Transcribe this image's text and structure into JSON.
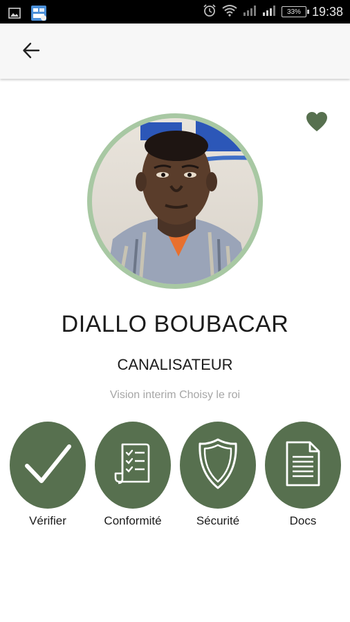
{
  "status_bar": {
    "time": "19:38",
    "battery": "33%",
    "left_icons": [
      "gallery-icon",
      "app-notification-icon"
    ],
    "right_icons": [
      "alarm-icon",
      "wifi-icon",
      "signal-icon",
      "signal-icon",
      "battery-icon"
    ]
  },
  "app_bar": {
    "back_icon": "arrow-left-icon"
  },
  "profile": {
    "name": "DIALLO BOUBACAR",
    "job_title": "CANALISATEUR",
    "agency": "Vision interim Choisy le roi",
    "favorite_icon": "heart-icon"
  },
  "actions": [
    {
      "label": "Vérifier",
      "icon": "checkmark-icon"
    },
    {
      "label": "Conformité",
      "icon": "checklist-icon"
    },
    {
      "label": "Sécurité",
      "icon": "shield-icon"
    },
    {
      "label": "Docs",
      "icon": "document-icon"
    }
  ],
  "colors": {
    "accent": "#57704f",
    "avatar_ring": "#a8c8a3",
    "heart": "#57704f",
    "app_bar": "#f7f7f7"
  }
}
